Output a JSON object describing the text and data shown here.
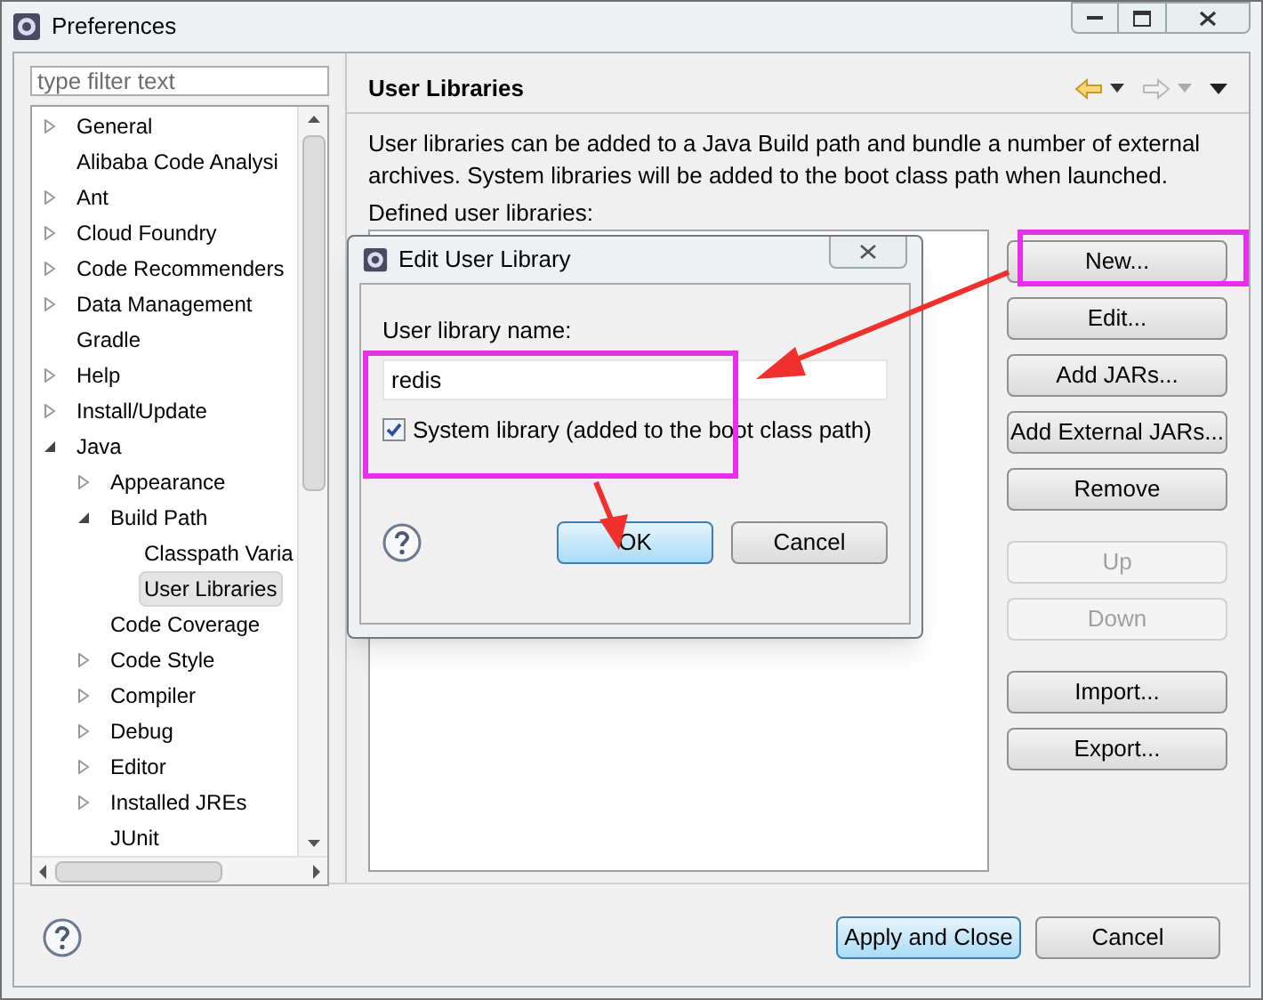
{
  "window": {
    "title": "Preferences"
  },
  "filter": {
    "placeholder": "type filter text"
  },
  "tree": [
    {
      "label": "General",
      "kind": "folder",
      "expanded": false,
      "selected": false
    },
    {
      "label": "Alibaba Code Analysi",
      "kind": "leaf",
      "selected": false
    },
    {
      "label": "Ant",
      "kind": "folder",
      "expanded": false,
      "selected": false
    },
    {
      "label": "Cloud Foundry",
      "kind": "folder",
      "expanded": false,
      "selected": false
    },
    {
      "label": "Code Recommenders",
      "kind": "folder",
      "expanded": false,
      "selected": false
    },
    {
      "label": "Data Management",
      "kind": "folder",
      "expanded": false,
      "selected": false
    },
    {
      "label": "Gradle",
      "kind": "leaf",
      "selected": false
    },
    {
      "label": "Help",
      "kind": "folder",
      "expanded": false,
      "selected": false
    },
    {
      "label": "Install/Update",
      "kind": "folder",
      "expanded": false,
      "selected": false
    },
    {
      "label": "Java",
      "kind": "folder",
      "expanded": true,
      "selected": false,
      "children": [
        {
          "label": "Appearance",
          "kind": "folder",
          "expanded": false,
          "selected": false
        },
        {
          "label": "Build Path",
          "kind": "folder",
          "expanded": true,
          "selected": false,
          "children": [
            {
              "label": "Classpath Varia",
              "kind": "leaf",
              "selected": false
            },
            {
              "label": "User Libraries",
              "kind": "leaf",
              "selected": true
            }
          ]
        },
        {
          "label": "Code Coverage",
          "kind": "leaf",
          "selected": false
        },
        {
          "label": "Code Style",
          "kind": "folder",
          "expanded": false,
          "selected": false
        },
        {
          "label": "Compiler",
          "kind": "folder",
          "expanded": false,
          "selected": false
        },
        {
          "label": "Debug",
          "kind": "folder",
          "expanded": false,
          "selected": false
        },
        {
          "label": "Editor",
          "kind": "folder",
          "expanded": false,
          "selected": false
        },
        {
          "label": "Installed JREs",
          "kind": "folder",
          "expanded": false,
          "selected": false
        },
        {
          "label": "JUnit",
          "kind": "leaf",
          "selected": false
        }
      ]
    }
  ],
  "page": {
    "title": "User Libraries",
    "description": "User libraries can be added to a Java Build path and bundle a number of external archives. System libraries will be added to the boot class path when launched.",
    "list_label": "Defined user libraries:"
  },
  "button_groups": [
    [
      {
        "label": "New...",
        "disabled": false
      },
      {
        "label": "Edit...",
        "disabled": false
      },
      {
        "label": "Add JARs...",
        "disabled": false
      },
      {
        "label": "Add External JARs...",
        "disabled": false
      },
      {
        "label": "Remove",
        "disabled": false
      }
    ],
    [
      {
        "label": "Up",
        "disabled": true
      },
      {
        "label": "Down",
        "disabled": true
      }
    ],
    [
      {
        "label": "Import...",
        "disabled": false
      },
      {
        "label": "Export...",
        "disabled": false
      }
    ]
  ],
  "footer_buttons": [
    {
      "label": "Apply and Close",
      "default": true
    },
    {
      "label": "Cancel",
      "default": false
    }
  ],
  "dialog": {
    "title": "Edit User Library",
    "name_label": "User library name:",
    "name_value": "redis",
    "system_library": {
      "label": "System library (added to the boot class path)",
      "checked": true
    },
    "buttons": [
      {
        "label": "OK",
        "default": true
      },
      {
        "label": "Cancel",
        "default": false
      }
    ]
  }
}
